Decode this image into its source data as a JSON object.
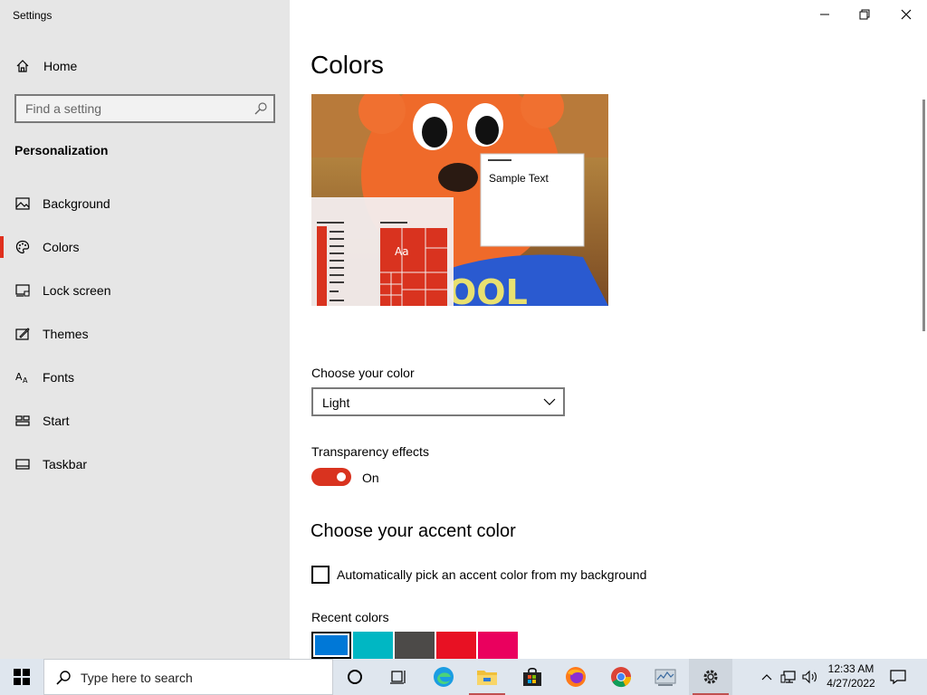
{
  "window": {
    "title": "Settings",
    "controls": [
      "minimize-icon",
      "restore-icon",
      "close-icon"
    ]
  },
  "sidebar": {
    "home_label": "Home",
    "search_placeholder": "Find a setting",
    "section_heading": "Personalization",
    "items": [
      {
        "label": "Background",
        "icon": "background-picture-icon",
        "active": false
      },
      {
        "label": "Colors",
        "icon": "palette-icon",
        "active": true
      },
      {
        "label": "Lock screen",
        "icon": "lock-screen-icon",
        "active": false
      },
      {
        "label": "Themes",
        "icon": "themes-brush-icon",
        "active": false
      },
      {
        "label": "Fonts",
        "icon": "fonts-icon",
        "active": false
      },
      {
        "label": "Start",
        "icon": "start-layout-icon",
        "active": false
      },
      {
        "label": "Taskbar",
        "icon": "taskbar-icon",
        "active": false
      }
    ]
  },
  "main": {
    "title": "Colors",
    "preview": {
      "sample_text": "Sample Text",
      "tile_text": "Aa",
      "accent_color": "#d9331f"
    },
    "choose_color_label": "Choose your color",
    "choose_color_value": "Light",
    "transparency_label": "Transparency effects",
    "transparency_state": "On",
    "accent_heading": "Choose your accent color",
    "auto_pick_label": "Automatically pick an accent color from my background",
    "auto_pick_checked": false,
    "recent_colors_label": "Recent colors",
    "recent_colors": [
      "#0078d7",
      "#00b7c3",
      "#4c4a48",
      "#e81123",
      "#ea005e"
    ]
  },
  "taskbar": {
    "search_placeholder": "Type here to search",
    "apps": [
      "cortana-icon",
      "task-view-icon",
      "edge-icon",
      "file-explorer-icon",
      "store-icon",
      "firefox-icon",
      "chrome-icon",
      "performance-monitor-icon",
      "settings-gear-icon"
    ],
    "tray_icons": [
      "chevron-up-icon",
      "network-icon",
      "volume-icon"
    ],
    "time": "12:33 AM",
    "date": "4/27/2022",
    "notification_icon": "action-center-icon"
  },
  "colors": {
    "accent": "#d9331f",
    "sidebar_bg": "#e6e6e6",
    "taskbar_bg": "#dfe6ee"
  }
}
